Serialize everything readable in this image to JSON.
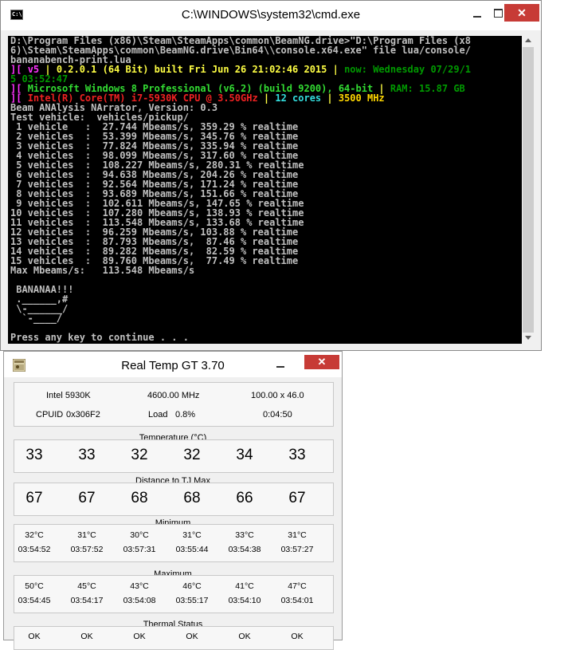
{
  "cmd_window": {
    "title": "C:\\WINDOWS\\system32\\cmd.exe",
    "icon_text": "C:\\",
    "close_label": "✕",
    "lines": [
      [
        {
          "t": "D:\\Program Files (x86)\\Steam\\SteamApps\\common\\BeamNG.drive>\"D:\\Program Files (x8",
          "c": "c-white"
        }
      ],
      [
        {
          "t": "6)\\Steam\\SteamApps\\common\\BeamNG.drive\\Bin64\\\\console.x64.exe\" file lua/console/",
          "c": "c-white"
        }
      ],
      [
        {
          "t": "bananabench-print.lua",
          "c": "c-white"
        }
      ],
      [
        {
          "t": "][ ",
          "c": "c-mag"
        },
        {
          "t": "v5",
          "c": "c-mag"
        },
        {
          "t": " | ",
          "c": "c-yel"
        },
        {
          "t": "0.2.0.1 (64 Bit) built Fri Jun 26 21:02:46 2015",
          "c": "c-yel"
        },
        {
          "t": " | ",
          "c": "c-yel"
        },
        {
          "t": "now: Wednesday 07/29/1",
          "c": "c-gr"
        }
      ],
      [
        {
          "t": "5 03:52:47",
          "c": "c-gr"
        }
      ],
      [
        {
          "t": "][ ",
          "c": "c-mag"
        },
        {
          "t": "Microsoft Windows 8 Professional (v6.2) (build 9200), 64-bit",
          "c": "c-brg"
        },
        {
          "t": " | ",
          "c": "c-yel"
        },
        {
          "t": "RAM: 15.87 GB",
          "c": "c-gr"
        }
      ],
      [
        {
          "t": "][ ",
          "c": "c-mag"
        },
        {
          "t": "Intel(R) Core(TM) i7-5930K CPU @ 3.50GHz",
          "c": "c-red"
        },
        {
          "t": " | ",
          "c": "c-yel"
        },
        {
          "t": "12 cores",
          "c": "c-cy"
        },
        {
          "t": " | ",
          "c": "c-yel"
        },
        {
          "t": "3500 MHz",
          "c": "c-gold"
        }
      ],
      [
        {
          "t": "Beam ANAlysis NArrator, Version: 0.3",
          "c": "c-white"
        }
      ],
      [
        {
          "t": "Test vehicle:  vehicles/pickup/",
          "c": "c-white"
        }
      ],
      [
        {
          "t": " 1 vehicle   :  27.744 Mbeams/s, 359.29 % realtime",
          "c": "c-white"
        }
      ],
      [
        {
          "t": " 2 vehicles  :  53.399 Mbeams/s, 345.76 % realtime",
          "c": "c-white"
        }
      ],
      [
        {
          "t": " 3 vehicles  :  77.824 Mbeams/s, 335.94 % realtime",
          "c": "c-white"
        }
      ],
      [
        {
          "t": " 4 vehicles  :  98.099 Mbeams/s, 317.60 % realtime",
          "c": "c-white"
        }
      ],
      [
        {
          "t": " 5 vehicles  :  108.227 Mbeams/s, 280.31 % realtime",
          "c": "c-white"
        }
      ],
      [
        {
          "t": " 6 vehicles  :  94.638 Mbeams/s, 204.26 % realtime",
          "c": "c-white"
        }
      ],
      [
        {
          "t": " 7 vehicles  :  92.564 Mbeams/s, 171.24 % realtime",
          "c": "c-white"
        }
      ],
      [
        {
          "t": " 8 vehicles  :  93.689 Mbeams/s, 151.66 % realtime",
          "c": "c-white"
        }
      ],
      [
        {
          "t": " 9 vehicles  :  102.611 Mbeams/s, 147.65 % realtime",
          "c": "c-white"
        }
      ],
      [
        {
          "t": "10 vehicles  :  107.280 Mbeams/s, 138.93 % realtime",
          "c": "c-white"
        }
      ],
      [
        {
          "t": "11 vehicles  :  113.548 Mbeams/s, 133.68 % realtime",
          "c": "c-white"
        }
      ],
      [
        {
          "t": "12 vehicles  :  96.259 Mbeams/s, 103.88 % realtime",
          "c": "c-white"
        }
      ],
      [
        {
          "t": "13 vehicles  :  87.793 Mbeams/s,  87.46 % realtime",
          "c": "c-white"
        }
      ],
      [
        {
          "t": "14 vehicles  :  89.282 Mbeams/s,  82.59 % realtime",
          "c": "c-white"
        }
      ],
      [
        {
          "t": "15 vehicles  :  89.760 Mbeams/s,  77.49 % realtime",
          "c": "c-white"
        }
      ],
      [
        {
          "t": "Max Mbeams/s:   113.548 Mbeams/s",
          "c": "c-white"
        }
      ],
      [
        {
          "t": "",
          "c": "c-white"
        }
      ],
      [
        {
          "t": " BANANAA!!!",
          "c": "c-white"
        }
      ],
      [
        {
          "t": " .______,#",
          "c": "c-white"
        }
      ],
      [
        {
          "t": " \\-______/",
          "c": "c-white"
        }
      ],
      [
        {
          "t": "  `-____/",
          "c": "c-white"
        }
      ],
      [
        {
          "t": "",
          "c": "c-white"
        }
      ],
      [
        {
          "t": "Press any key to continue . . .",
          "c": "c-white"
        }
      ]
    ]
  },
  "realtemp": {
    "title": "Real Temp GT 3.70",
    "close_label": "✕",
    "cpu_model": "Intel 5930K",
    "mhz": "4600.00 MHz",
    "multiplier": "100.00 x 46.0",
    "cpuid_label": "CPUID",
    "cpuid": "0x306F2",
    "load_label": "Load",
    "load": "0.8%",
    "uptime": "0:04:50",
    "temperature_label": "Temperature (°C)",
    "temperatures": [
      "33",
      "33",
      "32",
      "32",
      "34",
      "33"
    ],
    "distance_label": "Distance to TJ Max",
    "distances": [
      "67",
      "67",
      "68",
      "68",
      "66",
      "67"
    ],
    "minimum_label": "Minimum",
    "minimum_temps": [
      "32°C",
      "31°C",
      "30°C",
      "31°C",
      "33°C",
      "31°C"
    ],
    "minimum_times": [
      "03:54:52",
      "03:57:52",
      "03:57:31",
      "03:55:44",
      "03:54:38",
      "03:57:27"
    ],
    "maximum_label": "Maximum",
    "maximum_temps": [
      "50°C",
      "45°C",
      "43°C",
      "46°C",
      "41°C",
      "47°C"
    ],
    "maximum_times": [
      "03:54:45",
      "03:54:17",
      "03:54:08",
      "03:55:17",
      "03:54:10",
      "03:54:01"
    ],
    "thermal_label": "Thermal Status",
    "thermal": [
      "OK",
      "OK",
      "OK",
      "OK",
      "OK",
      "OK"
    ]
  }
}
